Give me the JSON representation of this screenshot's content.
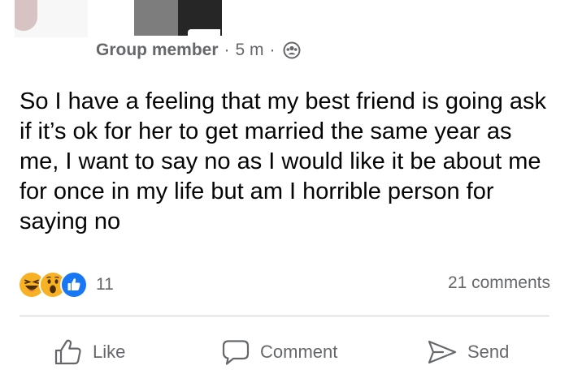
{
  "post": {
    "role": "Group member",
    "time": "5 m",
    "separator": "·",
    "audience_icon": "group-icon",
    "text": "So I have a feeling that my best friend is going ask if it’s ok for her to get married the same year as me, I want to say no as I would like it be about me for once in my life but am I horrible person for saying no"
  },
  "reactions": {
    "icons": [
      "haha-icon",
      "wow-icon",
      "like-icon"
    ],
    "count": "11",
    "comments": "21 comments"
  },
  "actions": {
    "like": "Like",
    "comment": "Comment",
    "send": "Send"
  },
  "colors": {
    "secondary_text": "#65676b",
    "primary_text": "#050505",
    "like_blue": "#1877f2",
    "reaction_yellow": "#f7b125"
  }
}
